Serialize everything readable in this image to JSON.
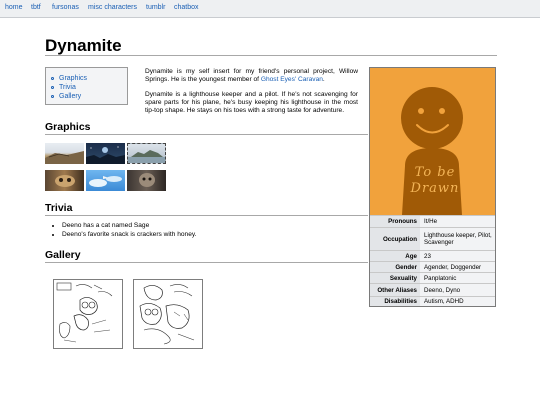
{
  "nav": {
    "items": [
      "home",
      "tbtf",
      "fursonas",
      "misc characters",
      "tumblr",
      "chatbox"
    ]
  },
  "page": {
    "title": "Dynamite"
  },
  "toc": {
    "items": [
      "Graphics",
      "Trivia",
      "Gallery"
    ]
  },
  "intro": {
    "p1_before": "Dynamite is my self insert for my friend's personal project, Willow Springs. He is the youngest member of ",
    "p1_link": "Ghost Eyes' Caravan",
    "p1_after": ".",
    "p2": "Dynamite is a lighthouse keeper and a pilot. If he's not scavenging for spare parts for his plane, he's busy keeping his lighthouse in the most tip-top shape. He stays on his toes with a strong taste for adventure."
  },
  "sections": {
    "graphics": "Graphics",
    "trivia": "Trivia",
    "gallery": "Gallery"
  },
  "trivia": {
    "items": [
      "Deeno has a cat named Sage",
      "Deeno's favorite snack is crackers with honey."
    ]
  },
  "portrait": {
    "placeholder_text": "To be Drawn",
    "bg_color": "#f1a23c",
    "figure_color": "#a05a06"
  },
  "infobox": {
    "rows": [
      {
        "label": "Pronouns",
        "value": "It/He"
      },
      {
        "label": "Occupation",
        "value": "Lighthouse keeper, Pilot, Scavenger"
      },
      {
        "label": "Age",
        "value": "23"
      },
      {
        "label": "Gender",
        "value": "Agender, Doggender"
      },
      {
        "label": "Sexuality",
        "value": "Panplatonic"
      },
      {
        "label": "Other Aliases",
        "value": "Deeno, Dyno"
      },
      {
        "label": "Disabilities",
        "value": "Autism, ADHD"
      }
    ]
  },
  "colors": {
    "link": "#1a5fb4",
    "nav_bg": "#eef0f2"
  }
}
